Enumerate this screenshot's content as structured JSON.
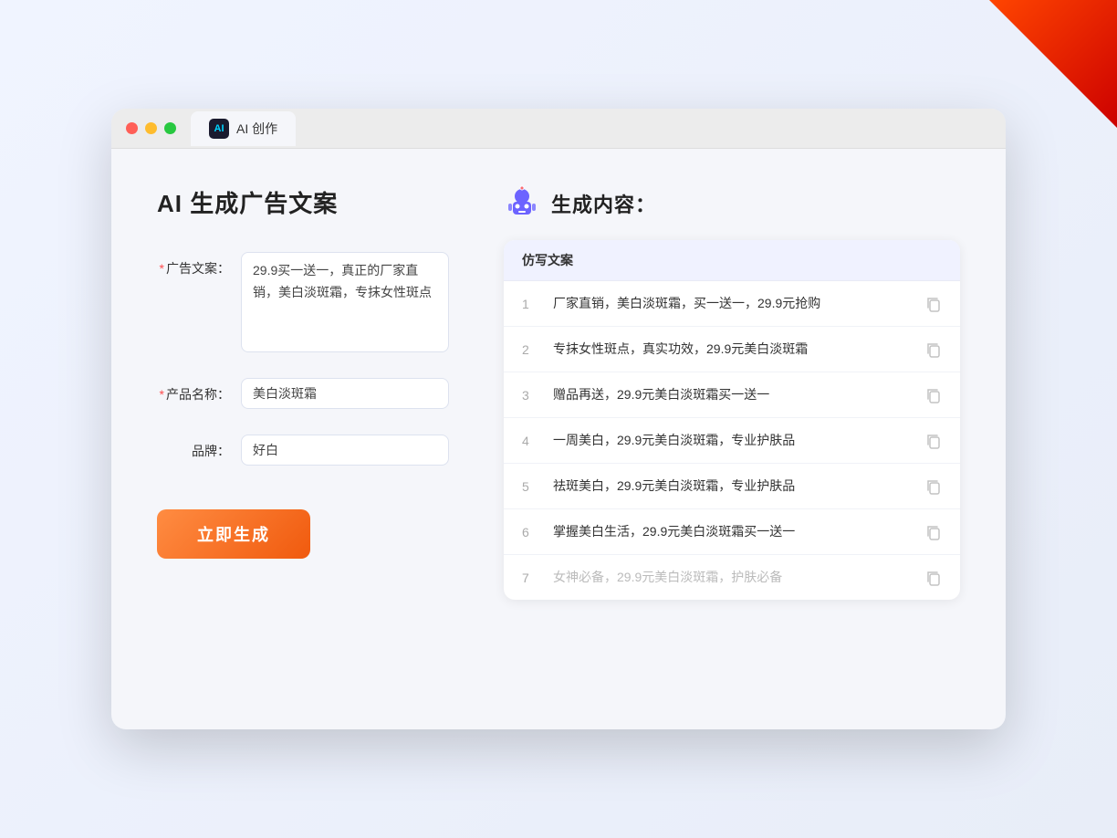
{
  "window": {
    "tab_label": "AI 创作"
  },
  "left": {
    "page_title": "AI 生成广告文案",
    "fields": [
      {
        "id": "ad_copy",
        "label": "广告文案：",
        "required": true,
        "value": "29.9买一送一，真正的厂家直销，美白淡斑霜，专抹女性斑点",
        "type": "textarea"
      },
      {
        "id": "product_name",
        "label": "产品名称：",
        "required": true,
        "value": "美白淡斑霜",
        "type": "input"
      },
      {
        "id": "brand",
        "label": "品牌：",
        "required": false,
        "value": "好白",
        "type": "input"
      }
    ],
    "generate_btn": "立即生成"
  },
  "right": {
    "result_title": "生成内容：",
    "table_header": "仿写文案",
    "rows": [
      {
        "num": 1,
        "text": "厂家直销，美白淡斑霜，买一送一，29.9元抢购",
        "faded": false
      },
      {
        "num": 2,
        "text": "专抹女性斑点，真实功效，29.9元美白淡斑霜",
        "faded": false
      },
      {
        "num": 3,
        "text": "赠品再送，29.9元美白淡斑霜买一送一",
        "faded": false
      },
      {
        "num": 4,
        "text": "一周美白，29.9元美白淡斑霜，专业护肤品",
        "faded": false
      },
      {
        "num": 5,
        "text": "祛斑美白，29.9元美白淡斑霜，专业护肤品",
        "faded": false
      },
      {
        "num": 6,
        "text": "掌握美白生活，29.9元美白淡斑霜买一送一",
        "faded": false
      },
      {
        "num": 7,
        "text": "女神必备，29.9元美白淡斑霜，护肤必备",
        "faded": true
      }
    ]
  }
}
